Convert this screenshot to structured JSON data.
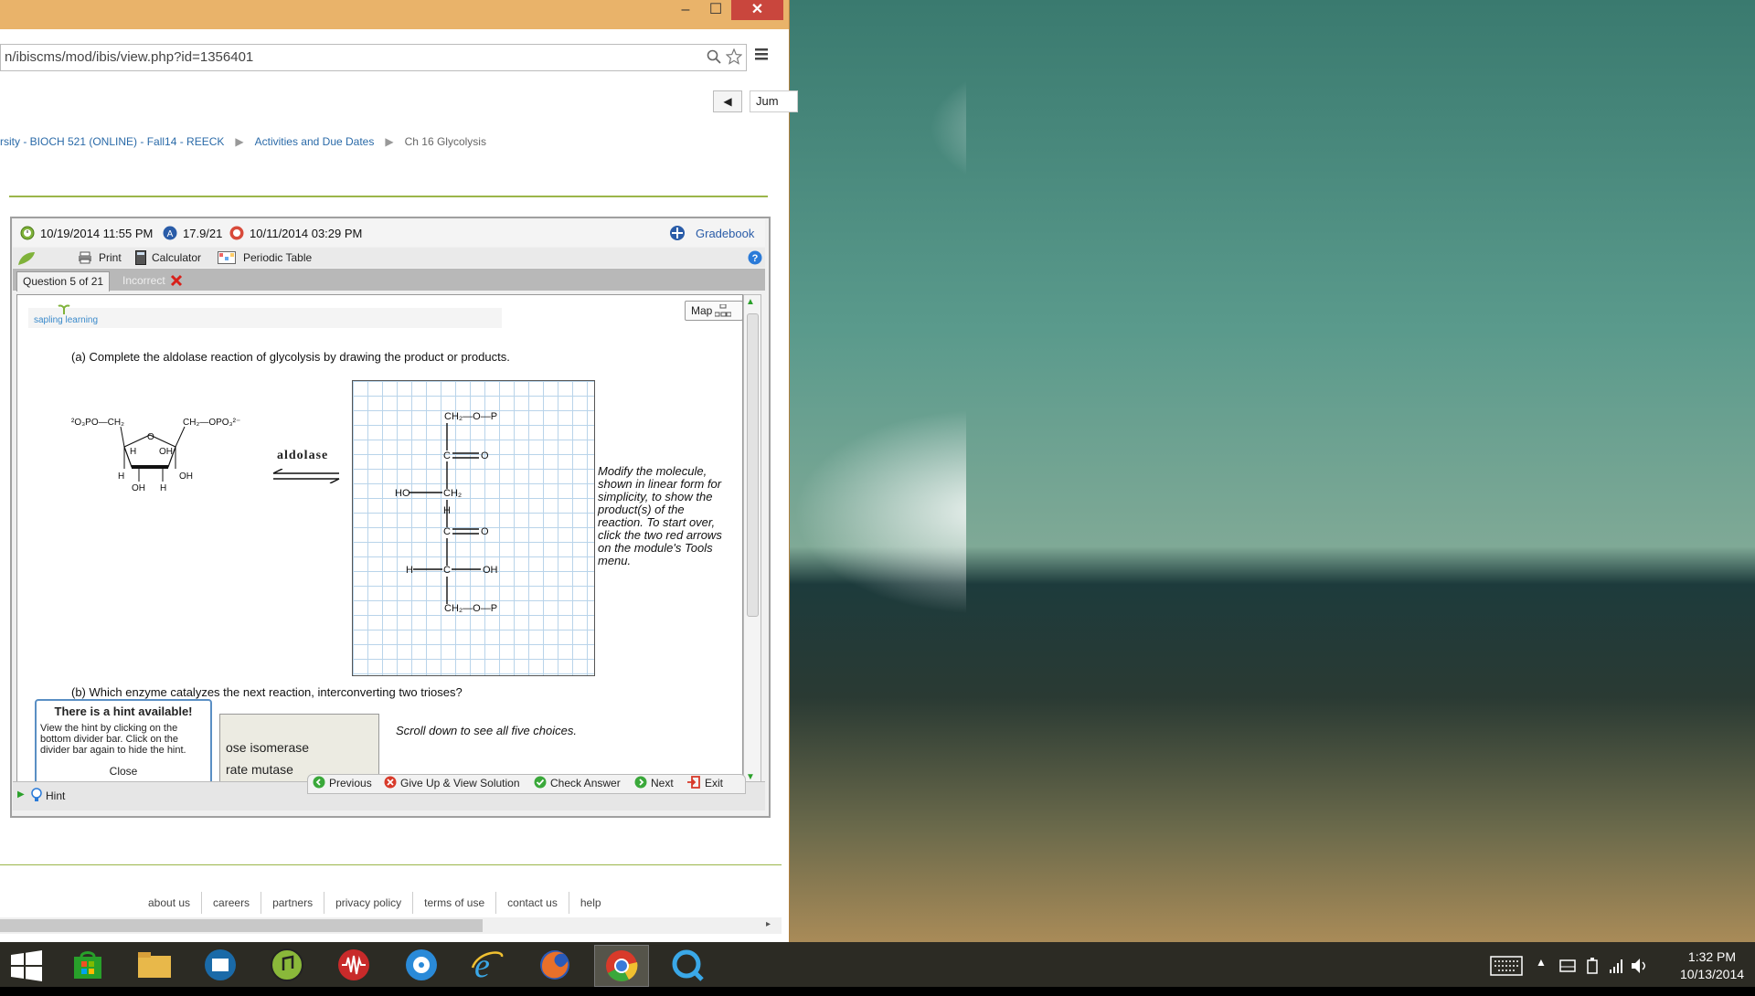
{
  "window": {
    "minimize": "–",
    "maximize": "☐",
    "close": "✕"
  },
  "address": {
    "url": "n/ibiscms/mod/ibis/view.php?id=1356401"
  },
  "nav": {
    "back": "◀",
    "jump": "Jum"
  },
  "breadcrumb": {
    "course": "rsity - BIOCH 521 (ONLINE) - Fall14 - REECK",
    "sep": "▶",
    "activities": "Activities and Due Dates",
    "chapter": "Ch 16 Glycolysis"
  },
  "info": {
    "due": "10/19/2014 11:55 PM",
    "score": "17.9/21",
    "submitted": "10/11/2014 03:29 PM",
    "gradebook": "Gradebook"
  },
  "toolbar": {
    "print": "Print",
    "calculator": "Calculator",
    "periodic": "Periodic Table"
  },
  "tabs": {
    "question": "Question 5 of 21",
    "status": "Incorrect"
  },
  "question": {
    "map": "Map",
    "logo": "sapling learning",
    "part_a": "(a) Complete the aldolase reaction of glycolysis by drawing the product or products.",
    "enzyme": "aldolase",
    "reactant": {
      "left_group": "²O₃PO—CH₂",
      "right_group": "CH₂—OPO₃²⁻",
      "ring_o": "O",
      "h1": "H",
      "oh1": "OH",
      "h2": "H",
      "h3": "H",
      "oh2": "OH",
      "oh3": "OH",
      "h4": "H"
    },
    "product": {
      "row1": "CH₂—O—P",
      "row2_c": "C",
      "row2_o": "O",
      "row3_ho": "HO",
      "row3_c": "CH₂",
      "row4_h": "H",
      "row5_c": "C",
      "row5_o": "O",
      "row6_h": "H",
      "row6_c": "C",
      "row6_oh": "OH",
      "row7": "CH₂—O—P"
    },
    "instructions": "Modify the molecule, shown in linear form for simplicity, to show the product(s) of the reaction. To start over, click the two red arrows on the module's Tools menu.",
    "part_b": "(b) Which enzyme catalyzes the next reaction, interconverting two trioses?",
    "scroll_note": "Scroll down to see all five choices.",
    "choices": [
      "ose isomerase",
      "rate mutase"
    ]
  },
  "hint": {
    "title": "There is a hint available!",
    "body": "View the hint by clicking on the bottom divider bar. Click on the divider bar again to hide the hint.",
    "close": "Close",
    "tab": "Hint"
  },
  "actions": {
    "previous": "Previous",
    "giveup": "Give Up & View Solution",
    "check": "Check Answer",
    "next": "Next",
    "exit": "Exit"
  },
  "footer": [
    "about us",
    "careers",
    "partners",
    "privacy policy",
    "terms of use",
    "contact us",
    "help"
  ],
  "clock": {
    "time": "1:32 PM",
    "date": "10/13/2014"
  },
  "colors": {
    "accent": "#9bb64a",
    "link": "#2a6aa8",
    "titlebar": "#e9b36a",
    "close": "#c9463d"
  }
}
